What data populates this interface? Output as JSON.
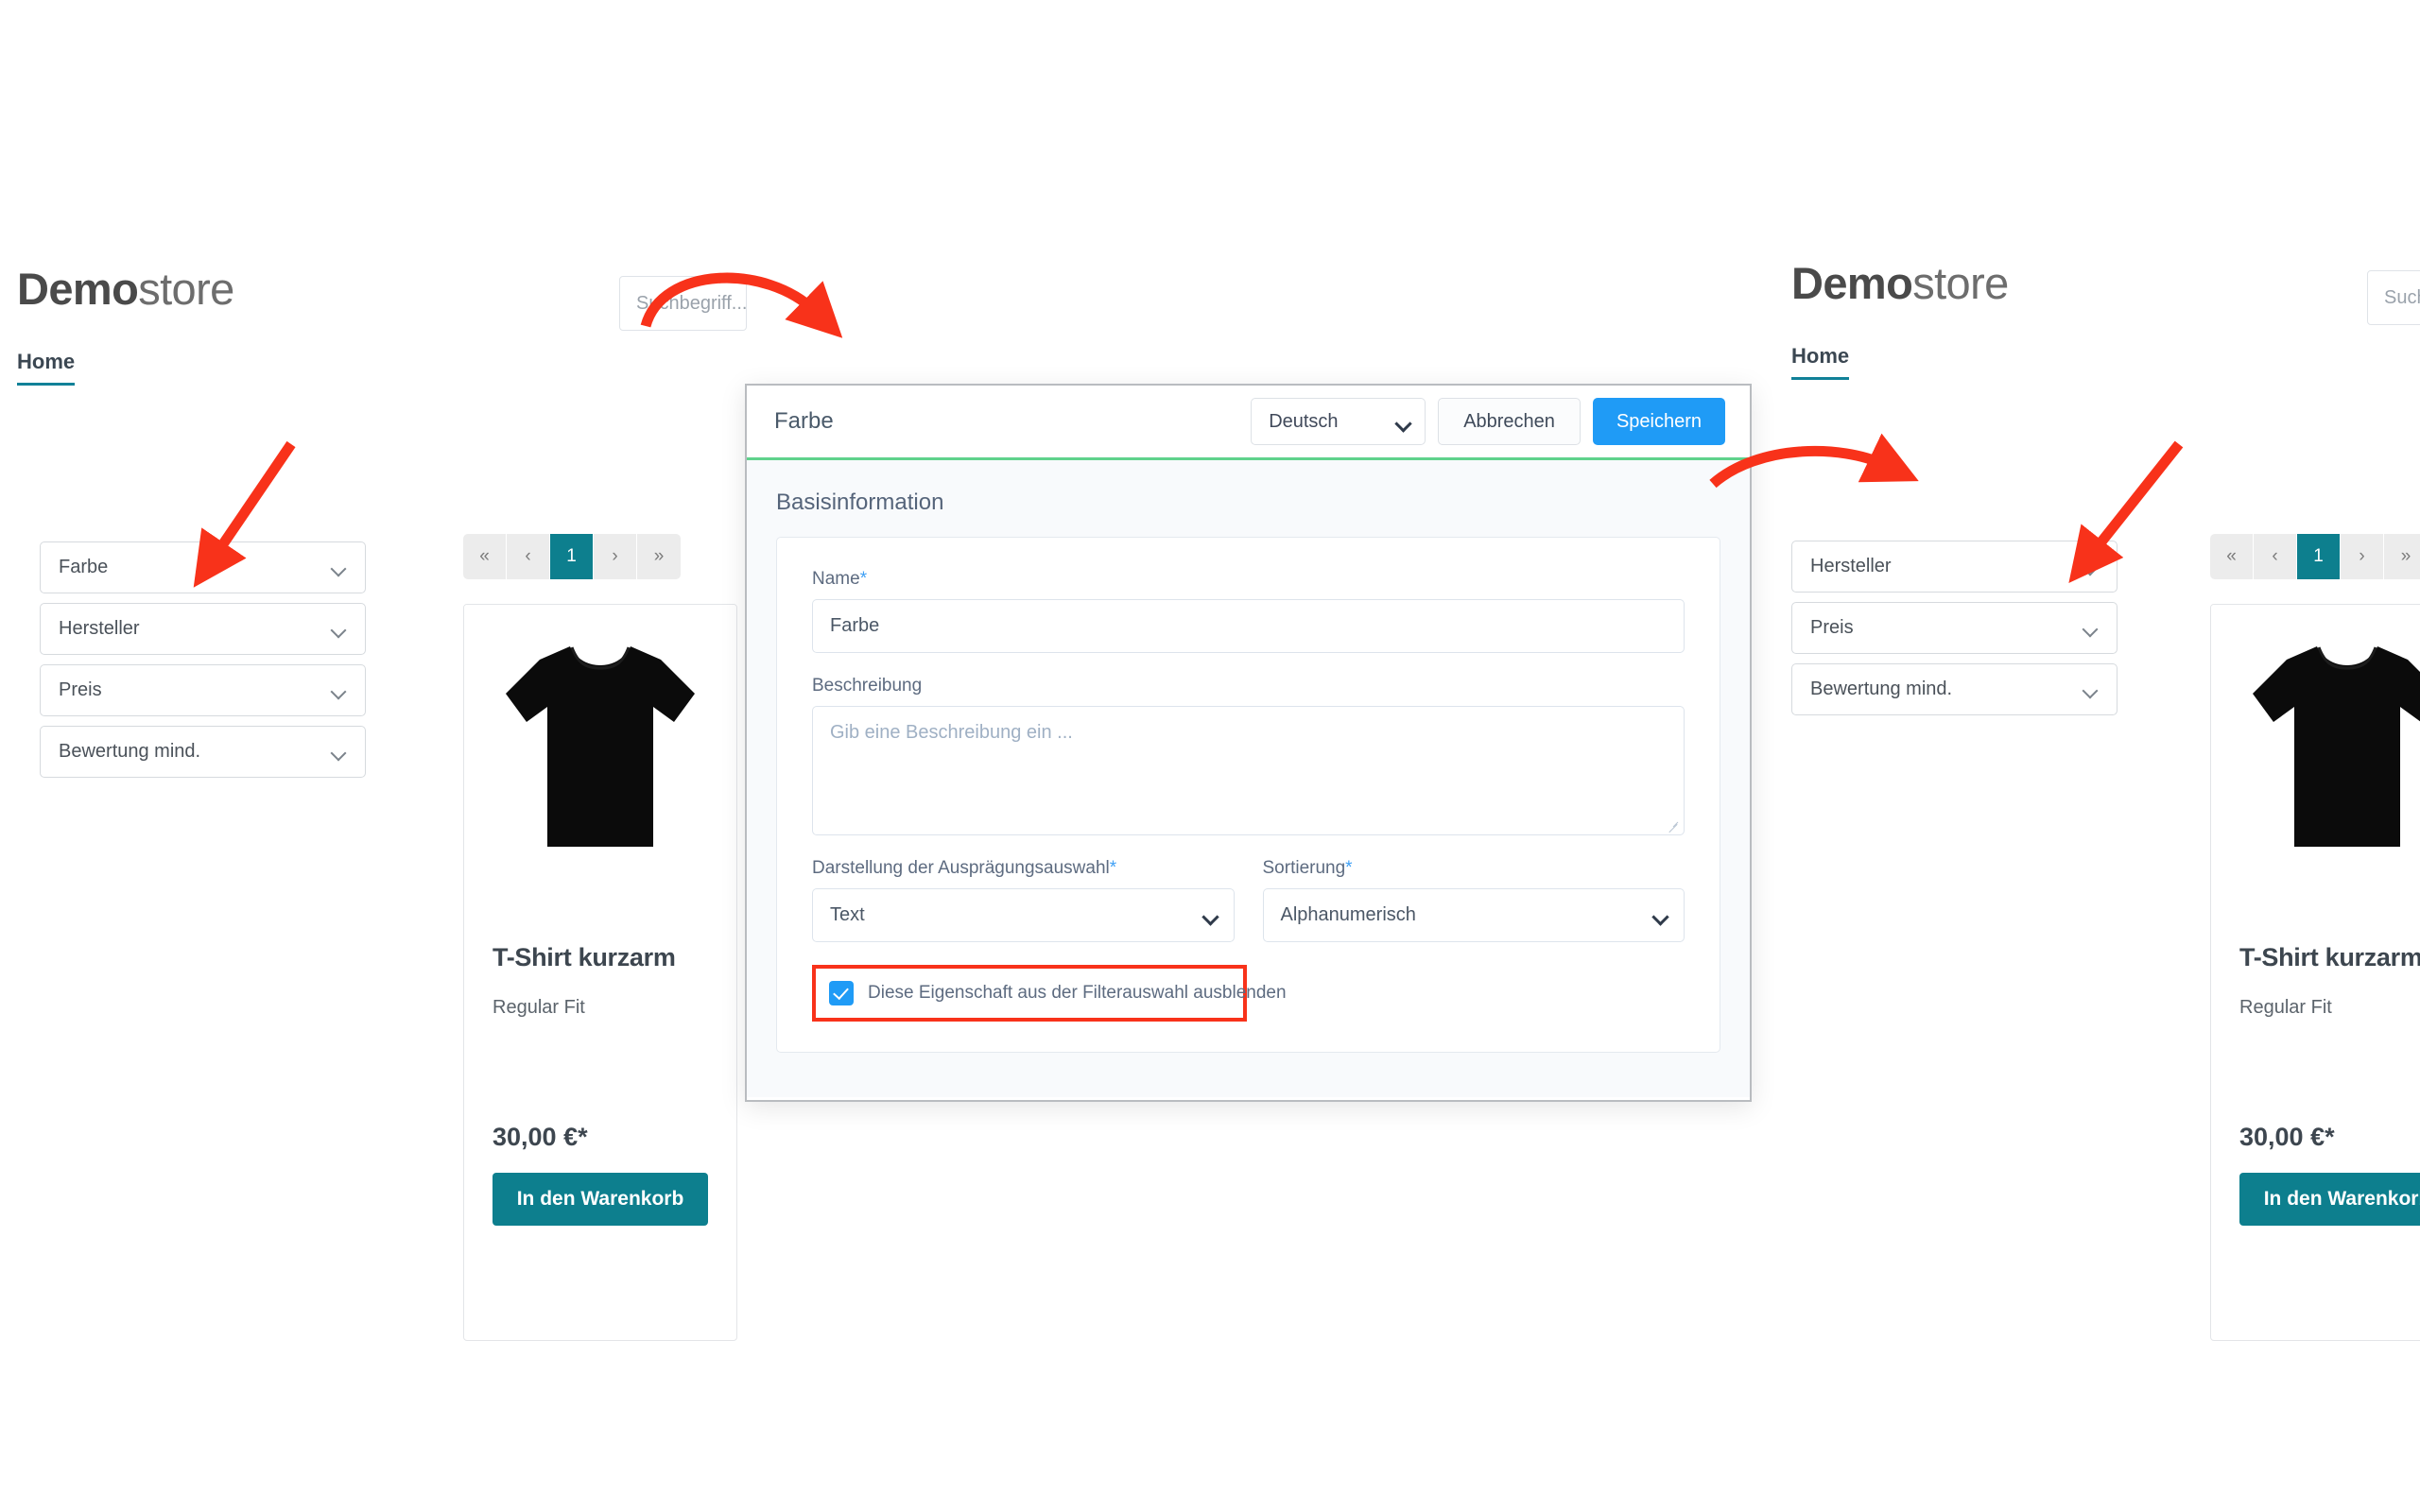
{
  "storefront": {
    "logo_bold": "Demo",
    "logo_light": "store",
    "nav": {
      "home": "Home"
    },
    "search": {
      "placeholder": "Suchbegriff..."
    },
    "filters_left": [
      {
        "label": "Farbe"
      },
      {
        "label": "Hersteller"
      },
      {
        "label": "Preis"
      },
      {
        "label": "Bewertung mind."
      }
    ],
    "filters_right": [
      {
        "label": "Hersteller"
      },
      {
        "label": "Preis"
      },
      {
        "label": "Bewertung mind."
      }
    ],
    "pagination": [
      {
        "label": "«",
        "name": "first",
        "active": false
      },
      {
        "label": "‹",
        "name": "prev",
        "active": false
      },
      {
        "label": "1",
        "name": "page-1",
        "active": true
      },
      {
        "label": "›",
        "name": "next",
        "active": false
      },
      {
        "label": "»",
        "name": "last",
        "active": false
      }
    ],
    "product": {
      "title": "T-Shirt kurzarm",
      "subtitle": "Regular Fit",
      "price": "30,00 €*",
      "cta": "In den Warenkorb"
    }
  },
  "modal": {
    "title": "Farbe",
    "language": "Deutsch",
    "cancel_label": "Abbrechen",
    "save_label": "Speichern",
    "section_title": "Basisinformation",
    "fields": {
      "name_label": "Name",
      "name_value": "Farbe",
      "description_label": "Beschreibung",
      "description_placeholder": "Gib eine Beschreibung ein ...",
      "display_label": "Darstellung der Ausprägungsauswahl",
      "display_value": "Text",
      "sorting_label": "Sortierung",
      "sorting_value": "Alphanumerisch",
      "required_marker": "*"
    },
    "checkbox": {
      "label": "Diese Eigenschaft aus der Filterauswahl ausblenden",
      "checked": true
    }
  },
  "annotations": {
    "accent_red": "#f8321a",
    "accent_teal": "#0d7f8e",
    "accent_blue": "#1f9bf6",
    "accent_green": "#5fd28c"
  }
}
